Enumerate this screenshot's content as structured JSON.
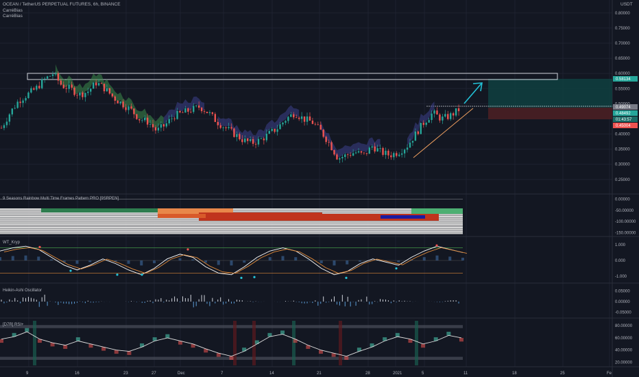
{
  "header": {
    "symbol_title": "OCEAN / TetherUS PERPETUAL FUTURES, 6h, BINANCE",
    "indicator_1": "CarréBias",
    "indicator_2": "CarréBias",
    "currency": "USDT"
  },
  "panes": {
    "rainbow_title": "9 Seasons Rainbow Multi Time Frames Pattern PRO [9SRPEN]",
    "wt_title": "WT_Kryp",
    "ha_title": "Heikin-Ashi Oscillator",
    "rsi_title": "[D7R] RSI+"
  },
  "price_badges": {
    "target": "0.58134",
    "entry": "0.49074",
    "last": "0.48492",
    "countdown": "01:43:57",
    "stop": "0.45004"
  },
  "colors": {
    "background": "#131722",
    "up": "#26a69a",
    "down": "#ef5350",
    "target_zone": "#0f3d3e",
    "stop_zone": "#4a1f23",
    "arrow": "#22c1d6",
    "trendline": "#f0a060",
    "wt_orange": "#e08a3a"
  },
  "chart_data": [
    {
      "type": "candlestick",
      "name": "OCEAN / TetherUS PERPETUAL FUTURES, 6h, BINANCE",
      "y_axis_ticks": [
        "0.80000",
        "0.75000",
        "0.70000",
        "0.65000",
        "0.60000",
        "0.55000",
        "0.50000",
        "0.45000",
        "0.40000",
        "0.35000",
        "0.30000",
        "0.25000"
      ],
      "ylim": [
        0.22,
        0.82
      ],
      "x_ticks": [
        "9",
        "16",
        "23",
        "27",
        "Dec",
        "7",
        "14",
        "21",
        "28",
        "2021",
        "5",
        "11",
        "18",
        "25",
        "Fe"
      ],
      "close_path": [
        0.42,
        0.47,
        0.51,
        0.53,
        0.55,
        0.58,
        0.6,
        0.56,
        0.55,
        0.53,
        0.54,
        0.57,
        0.55,
        0.52,
        0.5,
        0.48,
        0.45,
        0.44,
        0.41,
        0.43,
        0.46,
        0.47,
        0.48,
        0.49,
        0.47,
        0.44,
        0.42,
        0.4,
        0.38,
        0.37,
        0.38,
        0.4,
        0.42,
        0.45,
        0.47,
        0.45,
        0.44,
        0.41,
        0.37,
        0.32,
        0.33,
        0.34,
        0.33,
        0.36,
        0.34,
        0.33,
        0.34,
        0.36,
        0.4,
        0.44,
        0.47,
        0.45,
        0.46,
        0.48
      ],
      "rectangle_zone": [
        0.58,
        0.6
      ],
      "target": 0.58134,
      "entry": 0.49074,
      "stop": 0.45004,
      "last": 0.48492
    },
    {
      "type": "area",
      "name": "9 Seasons Rainbow Multi Time Frames Pattern PRO [9SRPEN]",
      "y_axis_ticks": [
        "0.00000",
        "-50.00000",
        "-100.00000",
        "-150.00000"
      ],
      "ylim": [
        -160,
        10
      ]
    },
    {
      "type": "line",
      "name": "WT_Kryp",
      "y_axis_ticks": [
        "1.000",
        "0.000",
        "-1.000"
      ],
      "ylim": [
        -1.3,
        1.3
      ],
      "series_wave": [
        0.6,
        0.8,
        0.9,
        0.7,
        0.2,
        -0.3,
        -0.6,
        -0.3,
        0.1,
        -0.2,
        -0.6,
        -0.9,
        -0.5,
        0.1,
        0.4,
        0.2,
        -0.4,
        -0.8,
        -0.9,
        -0.4,
        0.2,
        0.6,
        0.8,
        0.6,
        0.1,
        -0.5,
        -0.9,
        -0.7,
        -0.2,
        0.1,
        -0.1,
        -0.3,
        0.2,
        0.6,
        0.9,
        0.7,
        0.5
      ]
    },
    {
      "type": "bar",
      "name": "Heikin-Ashi Oscillator",
      "y_axis_ticks": [
        "0.05000",
        "0.00000",
        "-0.05000"
      ],
      "ylim": [
        -0.07,
        0.07
      ]
    },
    {
      "type": "line",
      "name": "[D7R] RSI+",
      "y_axis_ticks": [
        "80.00000",
        "60.00000",
        "40.00000",
        "20.00000"
      ],
      "ylim": [
        15,
        88
      ],
      "series_rsi": [
        58,
        62,
        70,
        58,
        52,
        48,
        55,
        50,
        45,
        40,
        38,
        45,
        55,
        60,
        55,
        50,
        42,
        35,
        30,
        38,
        50,
        62,
        66,
        58,
        48,
        40,
        35,
        30,
        38,
        45,
        55,
        62,
        58,
        50,
        55,
        64,
        60
      ]
    }
  ]
}
